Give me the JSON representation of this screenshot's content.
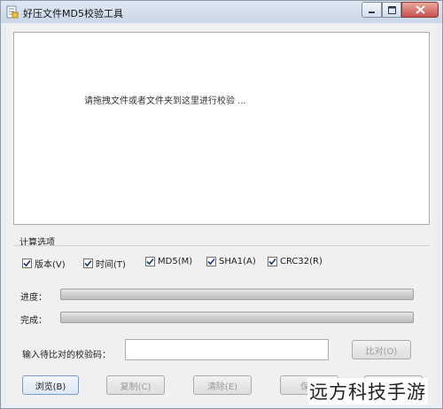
{
  "window": {
    "title": "好压文件MD5校验工具",
    "controls": {
      "minimize": "minimize-icon",
      "maximize": "maximize-icon",
      "close": "close-icon"
    }
  },
  "dropzone": {
    "hint": "请拖拽文件或者文件夹到这里进行校验 ..."
  },
  "options": {
    "label": "计算选项",
    "items": [
      {
        "label": "版本(V)",
        "checked": true
      },
      {
        "label": "时间(T)",
        "checked": true
      },
      {
        "label": "MD5(M)",
        "checked": true
      },
      {
        "label": "SHA1(A)",
        "checked": true
      },
      {
        "label": "CRC32(R)",
        "checked": true
      }
    ]
  },
  "progress": {
    "label": "进度：",
    "value": 0
  },
  "complete": {
    "label": "完成：",
    "value": 0
  },
  "compare": {
    "label": "输入待比对的校验码：",
    "value": "",
    "button": "比对(O)"
  },
  "buttons": {
    "browse": "浏览(B)",
    "copy": "复制(C)",
    "clear": "清除(E)",
    "save": "保存",
    "close": "关闭"
  },
  "watermark": "远方科技手游",
  "colors": {
    "accent": "#7a9cc4",
    "close_button": "#c75050"
  }
}
